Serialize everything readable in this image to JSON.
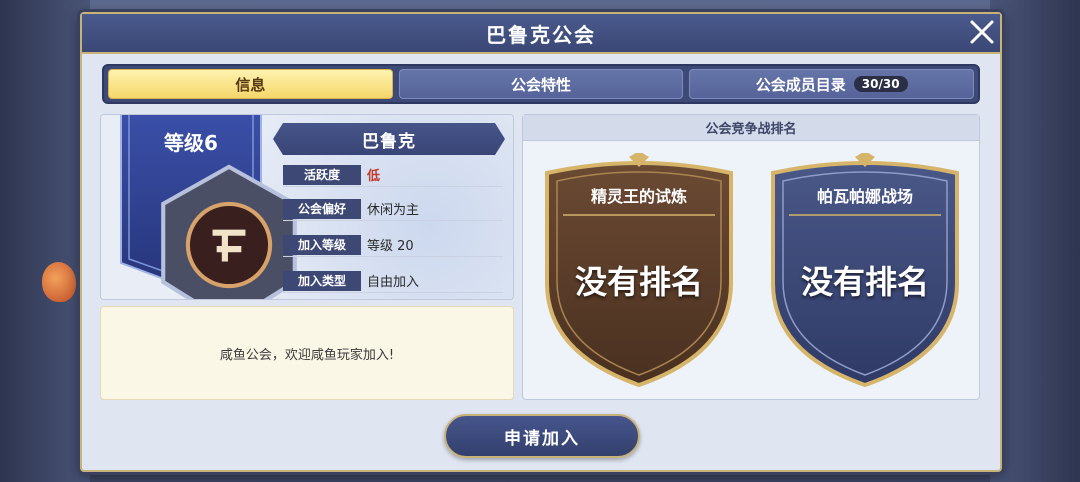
{
  "header": {
    "title": "巴鲁克公会"
  },
  "tabs": [
    {
      "label": "信息",
      "active": true
    },
    {
      "label": "公会特性",
      "active": false
    },
    {
      "label": "公会成员目录",
      "active": false,
      "count": "30/30"
    }
  ],
  "info": {
    "level_label": "等级6",
    "guild_name": "巴鲁克",
    "attributes": [
      {
        "key": "活跃度",
        "value": "低"
      },
      {
        "key": "公会偏好",
        "value": "休闲为主"
      },
      {
        "key": "加入等级",
        "value": "等级 20"
      },
      {
        "key": "加入类型",
        "value": "自由加入"
      }
    ],
    "description": "咸鱼公会，欢迎咸鱼玩家加入!"
  },
  "ranking": {
    "title": "公会竞争战排名",
    "entries": [
      {
        "name": "精灵王的试炼",
        "rank": "没有排名",
        "color": "#5b3f2b"
      },
      {
        "name": "帕瓦帕娜战场",
        "rank": "没有排名",
        "color": "#3a4670"
      }
    ]
  },
  "join_button": {
    "label": "申请加入"
  },
  "colors": {
    "gold": "#c7b27a",
    "navy": "#3b4876",
    "active_tab": "#f5d66a",
    "low_status": "#c0392b"
  }
}
